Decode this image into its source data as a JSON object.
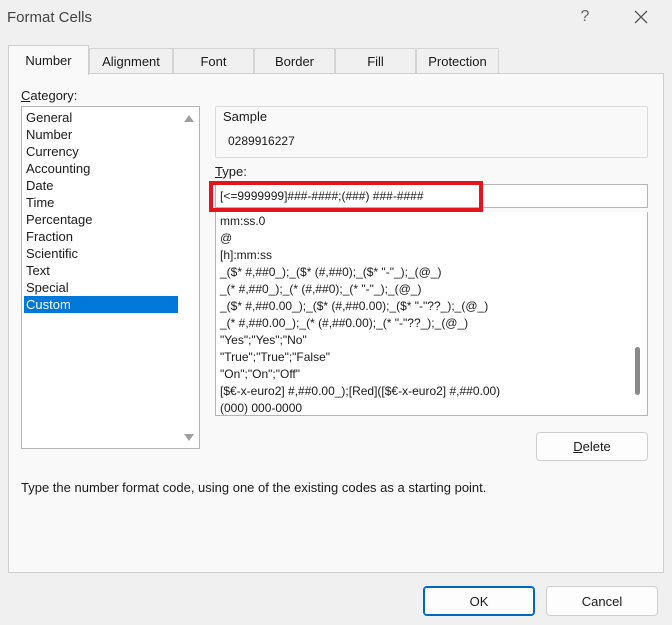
{
  "window": {
    "title": "Format Cells",
    "help_label": "?"
  },
  "tabs": [
    {
      "label": "Number",
      "active": true
    },
    {
      "label": "Alignment",
      "active": false
    },
    {
      "label": "Font",
      "active": false
    },
    {
      "label": "Border",
      "active": false
    },
    {
      "label": "Fill",
      "active": false
    },
    {
      "label": "Protection",
      "active": false
    }
  ],
  "category": {
    "label_first": "C",
    "label_rest": "ategory:",
    "items": [
      "General",
      "Number",
      "Currency",
      "Accounting",
      "Date",
      "Time",
      "Percentage",
      "Fraction",
      "Scientific",
      "Text",
      "Special",
      "Custom"
    ],
    "selected": "Custom"
  },
  "sample": {
    "label": "Sample",
    "value": "0289916227"
  },
  "type": {
    "label_first": "T",
    "label_rest": "ype:",
    "value": "[<=9999999]###-####;(###) ###-####"
  },
  "formats": [
    "mm:ss.0",
    "@",
    "[h]:mm:ss",
    "_($* #,##0_);_($* (#,##0);_($* \"-\"_);_(@_)",
    "_(* #,##0_);_(* (#,##0);_(* \"-\"_);_(@_)",
    "_($* #,##0.00_);_($* (#,##0.00);_($* \"-\"??_);_(@_)",
    "_(* #,##0.00_);_(* (#,##0.00);_(* \"-\"??_);_(@_)",
    "\"Yes\";\"Yes\";\"No\"",
    "\"True\";\"True\";\"False\"",
    "\"On\";\"On\";\"Off\"",
    "[$€-x-euro2] #,##0.00_);[Red]([$€-x-euro2] #,##0.00)",
    "(000) 000-0000"
  ],
  "buttons": {
    "delete_first": "D",
    "delete_rest": "elete",
    "ok": "OK",
    "cancel": "Cancel"
  },
  "hint": "Type the number format code, using one of the existing codes as a starting point.",
  "colors": {
    "selection": "#0078d7",
    "highlight_border": "#e3141c",
    "ok_border": "#0067c0"
  }
}
